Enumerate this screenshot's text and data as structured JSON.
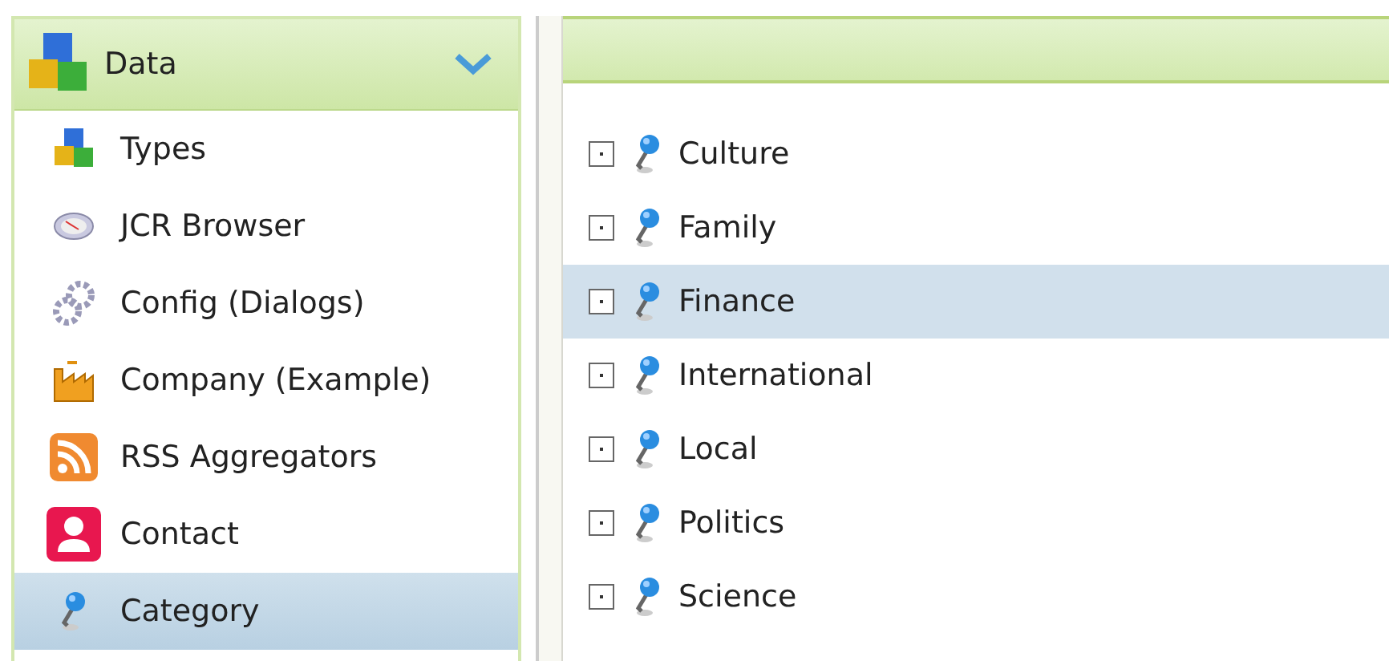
{
  "sidebar": {
    "header": {
      "title": "Data",
      "expanded": true
    },
    "items": [
      {
        "label": "Types",
        "kind": "cubes",
        "selected": false
      },
      {
        "label": "JCR Browser",
        "kind": "compass",
        "selected": false
      },
      {
        "label": "Config (Dialogs)",
        "kind": "gears",
        "selected": false
      },
      {
        "label": "Company (Example)",
        "kind": "factory",
        "selected": false
      },
      {
        "label": "RSS Aggregators",
        "kind": "rss",
        "selected": false
      },
      {
        "label": "Contact",
        "kind": "contact",
        "selected": false
      },
      {
        "label": "Category",
        "kind": "pin",
        "selected": true
      }
    ]
  },
  "tree": {
    "rows": [
      {
        "label": "Culture",
        "selected": false
      },
      {
        "label": "Family",
        "selected": false
      },
      {
        "label": "Finance",
        "selected": true
      },
      {
        "label": "International",
        "selected": false
      },
      {
        "label": "Local",
        "selected": false
      },
      {
        "label": "Politics",
        "selected": false
      },
      {
        "label": "Science",
        "selected": false
      }
    ]
  }
}
